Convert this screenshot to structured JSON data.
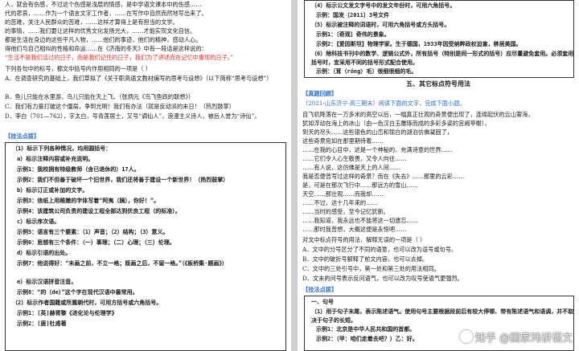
{
  "left": {
    "para_lines": [
      "人，就会有伤感，不过这个伤感是浅层的情感，是中学语文课本中的伤感……",
      "代的悲哀，……作为一个语言文字工作者，……在写作中自然而然地写出来了。",
      "的苦难，关注人民群众的苦难，……这样才算得上是有担当的文学。",
      "的事情，……我们要让这样的优秀文化发扬光大，……才能实现文化自信。",
      "都是生活在身边的这些平凡人物，……他们的事迹，他们的精神，感动人心。",
      "得他们与自己相似的性格和命运……在《济南的冬天》中有一段话是这样说的：",
      "“生活不是我们活过的日子，而是我们记住的日子，我们为了讲述而在记忆中重现的日子。”"
    ],
    "question": "下列各句中的标号，都文中括号内作用相同的一项是（ ）",
    "options": [
      "A．在调查研究的基础上，我们草拟了《关于职高语文教材编写的思考与设想》（以下简称“思考与设想”）",
      "B．鱼儿只能在水里游，鸟儿只能在天上飞。（张炳元《鸟飞鱼跃的联想》）",
      "C．我们有力量打破这个僵局，争到光明！我们有办法（就是反动派的末日！（热烈鼓掌）",
      "D．李白（701—762），字太白，号青莲居士，又号“谪仙人”，浪漫主义诗人，被后人誉为“诗仙”。"
    ],
    "section_label": "【技法点拨】",
    "box_lines": [
      "（1）标示下列各种情况，均用圆括号：",
      "a）标示注释内容或补充说明。",
      "示例1：我校拥有特级教师（含已退休的）17人。",
      "示例2：我们不但善于破坏一个旧世界，我们还将善于建设一个新世界！（热烈鼓掌）",
      "b）标示订正或补加的文字。",
      "示例3：信纸上用稚嫩的字体写着“阿夷（姨），你好！”。",
      "示例4：该建筑公司负责的建设工程全部达到优良工程（的标准）。",
      "c）标示序次语。",
      "示例5：语言有三个要素：（1）声音；（2）结构；（3）意义。",
      "示例6：思想有三个条件：（一）事理；（二）心理；（三）伦理。",
      "d）标示引语的出处。",
      "示例7：他说得好：“未画之前，不立一格；既画之后，不留一格。”（《板桥集·题画》）",
      "e）标示汉语拼音注音。",
      "示例8：“的（de）”这个字在现代汉语中最常用。",
      "（2）标示作者国籍或所属朝代时，可用方括号或六角括号。",
      "示例1：[英]赫胥黎《进化论与伦理学》",
      "示例2：[唐]杜甫著"
    ]
  },
  "right": {
    "box_top_lines": [
      "（4）标示公文发文字号中的发文年份时，可用六角括号。",
      "示例：国发〔2011〕3号文件",
      "（5）标示被注释的词语时，可用六角括号或方头括号。",
      "示例1：〔奇观〕奇伟的景象。",
      "示例2：【爱因斯坦】物理学家。生于德国，1933年因受纳粹政权迫害，移居美国。",
      "（6）除科技书刊中的数学、逻辑公式外，所有括号（特别是同一形式的括号）应尽量避免套用。必须套用括号时，宜采用不同的括号形式配合使用。",
      "示例：〔茸（róng）毛〕很细很细的毛。"
    ],
    "heading": "五、其它标点符号用法",
    "real_label": "【真题回顾】",
    "exam_intro": "（2021·山东济宁·高三期末）阅读下面的文字，完成下面小题。",
    "passage_lines": [
      "自飞机降落在一万多米的高空以后，一幅真正壮观的奇景便出现了，连绵起伏的云山雾海，",
      "犹如浮动在海上的冰山（由一色汉白玉雕琢而成的多彩多姿的宫阙亭榭），",
      "到天的尽头……这些银色的山峦和锦白的湖泊仿佛凝固了，",
      "这些奇景宛如在那里期待着……",
      "……在我的心目中，这是一个神秘的、充满诗意的世界……",
      "……它们令人心生敬畏，又令人向往……",
      "……有人说，这仿佛是天上的人间……",
      "我是否便曾写过这样的奇景？而在《失去》……那里的云彩……",
      "是，可是在那次飞行中……那远方的雪山……",
      "天空……那壮观……而我却……",
      "……不过，这十几年来的……",
      "……当时的感受，至今记忆犹新。",
      "……我知道，我永远也不能将这一切遗忘……",
      "……那时我曾想，大概这便是永恒吧……"
    ],
    "question": "对文中标点符号的用法，解释无误的一项是（ ）",
    "options": [
      "A．文中的分号区分了不同的语意，也可以改为逗号或句号。",
      "B．文中的破折号解释了前文内容，也可以去掉。",
      "C．文中的三处引号中，第一处和第三处的用法相同。",
      "D．文末的问号表示反问语气，也可以改为叹号使语气更强烈。"
    ],
    "tips_label": "【技法点拨】",
    "box2_lines": [
      "一、句号",
      "（1）用于句子末尾，表示陈述语气。使用句号主要根据段前后有较大停顿、带有陈述语气和语调，并不取决于句子的长短。",
      "示例1：北京是中华人民共和国的首都。",
      "示例2：（甲：咱们走着去吧？）乙：好。"
    ]
  },
  "watermark": "知乎 @国家玮讲语文"
}
